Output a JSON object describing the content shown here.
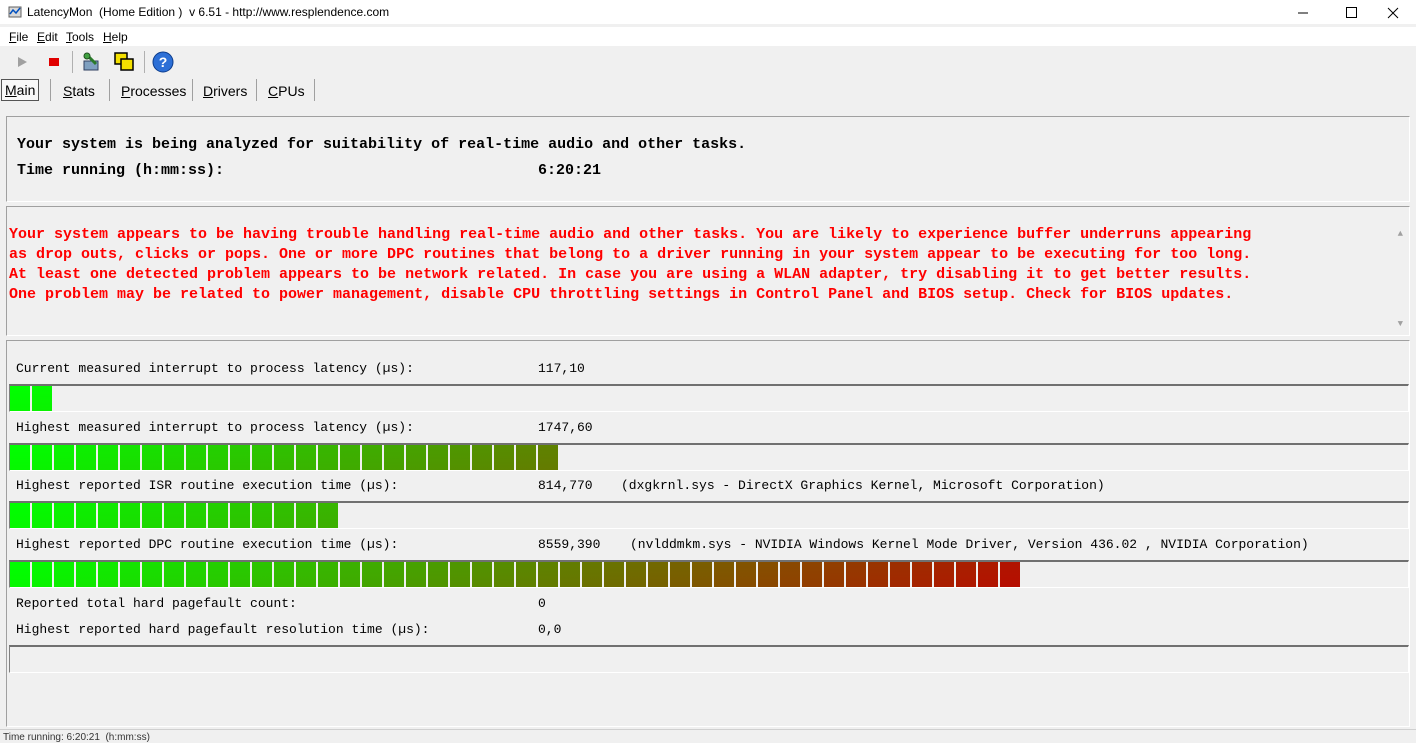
{
  "window": {
    "title": "LatencyMon  (Home Edition )  v 6.51 - http://www.resplendence.com",
    "minimize_icon": "minimize-icon",
    "maximize_icon": "maximize-icon",
    "close_icon": "close-icon"
  },
  "menu": {
    "items": [
      {
        "accel": "F",
        "rest": "ile"
      },
      {
        "accel": "E",
        "rest": "dit"
      },
      {
        "accel": "T",
        "rest": "ools"
      },
      {
        "accel": "H",
        "rest": "elp"
      }
    ]
  },
  "toolbar": {
    "start_icon": "play-icon",
    "stop_icon": "stop-icon",
    "analyze_icon": "analyze-icon",
    "windows_icon": "windows-icon",
    "help_icon": "help-icon",
    "accent": "#e00000"
  },
  "tabs": [
    {
      "accel": "M",
      "rest": "ain"
    },
    {
      "accel": "S",
      "rest": "tats"
    },
    {
      "accel": "P",
      "rest": "rocesses"
    },
    {
      "accel": "D",
      "rest": "rivers"
    },
    {
      "accel": "C",
      "rest": "PUs"
    }
  ],
  "summary": {
    "analyzing": "Your system is being analyzed for suitability of real-time audio and other tasks.",
    "time_label": "Time running (h:mm:ss):",
    "time_value": "6:20:21"
  },
  "warning": {
    "lines": [
      "Your system appears to be having trouble handling real-time audio and other tasks. You are likely to experience buffer underruns appearing",
      "as drop outs, clicks or pops. One or more DPC routines that belong to a driver running in your system appear to be executing for too long.",
      "At least one detected problem appears to be network related. In case you are using a WLAN adapter, try disabling it to get better results.",
      "One problem may be related to power management, disable CPU throttling settings in Control Panel and BIOS setup. Check for BIOS updates."
    ],
    "color": "#ff0000",
    "scroll_up": "▲",
    "scroll_down": "▼"
  },
  "metrics": {
    "current_latency": {
      "label": "Current measured interrupt to process latency (µs):",
      "value": "117,10",
      "bar_level": 0.029
    },
    "highest_latency": {
      "label": "Highest measured interrupt to process latency (µs):",
      "value": "1747,60",
      "bar_level": 0.403
    },
    "isr": {
      "label": "Highest reported ISR routine execution time (µs):",
      "value": "814,770",
      "detail": "(dxgkrnl.sys - DirectX Graphics Kernel, Microsoft Corporation)",
      "bar_level": 0.234
    },
    "dpc": {
      "label": "Highest reported DPC routine execution time (µs):",
      "value": "8559,390",
      "detail": "(nvlddmkm.sys - NVIDIA Windows Kernel Mode Driver, Version 436.02 , NVIDIA Corporation)",
      "bar_level": 0.737
    },
    "pagefault_count": {
      "label": "Reported total hard pagefault count:",
      "value": "0"
    },
    "pagefault_time": {
      "label": "Highest reported hard pagefault resolution time (µs):",
      "value": "0,0",
      "bar_level": 0
    }
  },
  "status": {
    "text": "Time running: 6:20:21  (h:mm:ss)"
  },
  "colors": {
    "bar_start": "#00ff00",
    "bar_end": "#c00000"
  }
}
